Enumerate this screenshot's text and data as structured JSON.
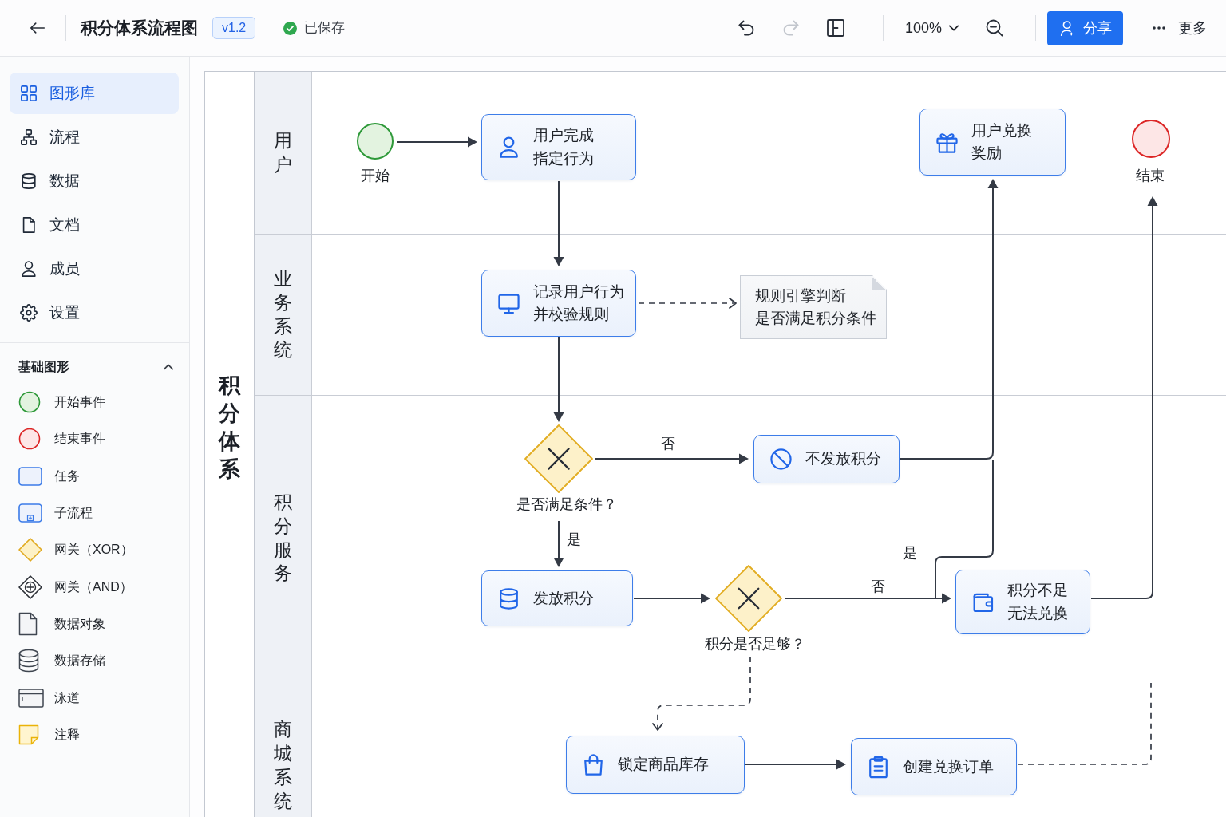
{
  "header": {
    "title": "积分体系流程图",
    "version": "v1.2",
    "save_status": "已保存",
    "history_buttons": [
      {
        "disabled": false
      },
      {
        "disabled": true
      }
    ],
    "zoom": "100%",
    "share_button": "分享",
    "more_button": "更多"
  },
  "sidebar": {
    "nav": [
      {
        "label": "图形库",
        "selected": true
      },
      {
        "label": "流程",
        "selected": false
      },
      {
        "label": "数据",
        "selected": false
      },
      {
        "label": "文档",
        "selected": false
      },
      {
        "label": "成员",
        "selected": false
      },
      {
        "label": "设置",
        "selected": false
      }
    ],
    "shape_section": {
      "title": "基础图形",
      "expanded": true,
      "shapes": [
        {
          "label": "开始事件"
        },
        {
          "label": "结束事件"
        },
        {
          "label": "任务"
        },
        {
          "label": "子流程"
        },
        {
          "label": "网关（XOR）"
        },
        {
          "label": "网关（AND）"
        },
        {
          "label": "数据对象"
        },
        {
          "label": "数据存储"
        },
        {
          "label": "泳道"
        },
        {
          "label": "注释"
        }
      ]
    }
  },
  "diagram": {
    "pool": "积分体系",
    "lanes": [
      {
        "label": "用户",
        "nodes": [
          {
            "kind": "start",
            "label": "开始"
          },
          {
            "kind": "task",
            "label": "用户完成指定行为"
          },
          {
            "kind": "task",
            "label": "用户兑换奖励"
          },
          {
            "kind": "end",
            "label": "结束"
          }
        ]
      },
      {
        "label": "业务系统",
        "nodes": [
          {
            "kind": "task",
            "label": "记录用户行为并校验规则"
          },
          {
            "kind": "annotation",
            "label": "规则引擎判断是否满足积分条件"
          }
        ]
      },
      {
        "label": "积分服务",
        "nodes": [
          {
            "kind": "gateway",
            "label": "是否满足条件？"
          },
          {
            "kind": "task",
            "label": "不发放积分"
          },
          {
            "kind": "task",
            "label": "发放积分"
          },
          {
            "kind": "gateway",
            "label": "积分是否足够？"
          },
          {
            "kind": "task",
            "label": "积分不足无法兑换"
          }
        ]
      },
      {
        "label": "商城系统",
        "nodes": [
          {
            "kind": "task",
            "label": "锁定商品库存"
          },
          {
            "kind": "task",
            "label": "创建兑换订单"
          }
        ]
      }
    ],
    "edges": [
      {
        "kind": "flow"
      },
      {
        "kind": "flow"
      },
      {
        "kind": "association"
      },
      {
        "kind": "flow"
      },
      {
        "kind": "flow",
        "label": "否"
      },
      {
        "kind": "flow",
        "label": "是"
      },
      {
        "kind": "flow"
      },
      {
        "kind": "flow",
        "label": "是"
      },
      {
        "kind": "flow"
      },
      {
        "kind": "flow",
        "label": "否"
      },
      {
        "kind": "flow"
      },
      {
        "kind": "association"
      },
      {
        "kind": "flow"
      },
      {
        "kind": "association"
      }
    ]
  }
}
